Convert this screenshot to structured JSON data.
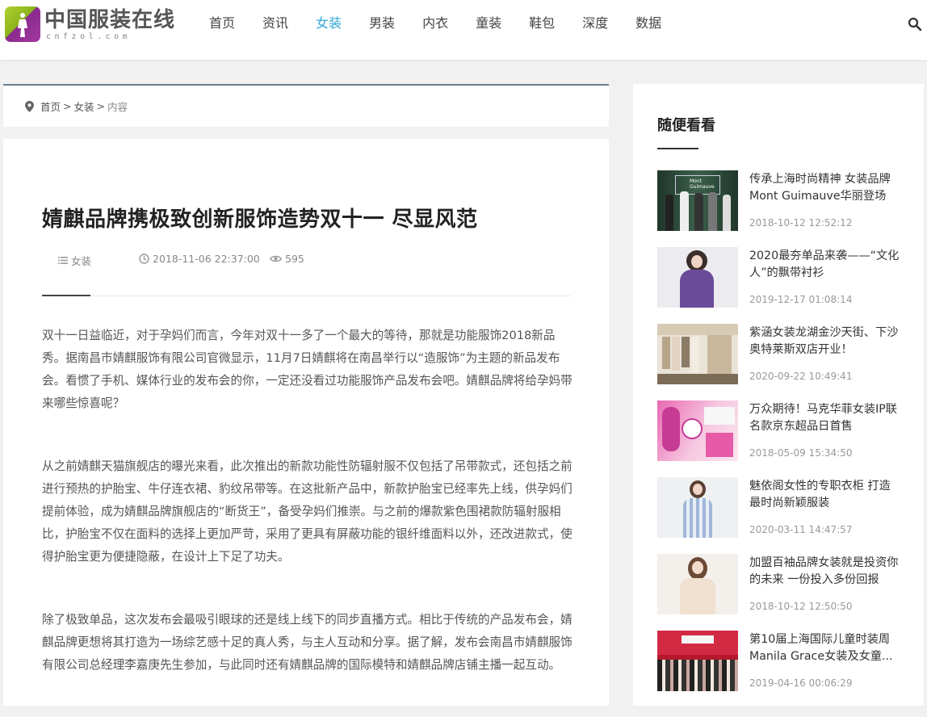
{
  "header": {
    "logo_text": "中国服装在线",
    "logo_sub": "cnfzol.com",
    "nav": [
      "首页",
      "资讯",
      "女装",
      "男装",
      "内衣",
      "童装",
      "鞋包",
      "深度",
      "数据"
    ],
    "active_nav": "女装"
  },
  "breadcrumb": {
    "home": "首页",
    "section": "女装",
    "current": "内容",
    "sep": ">"
  },
  "article": {
    "title": "婧麒品牌携极致创新服饰造势双十一 尽显风范",
    "category": "女装",
    "datetime": "2018-11-06 22:37:00",
    "views": "595",
    "paragraphs": [
      "双十一日益临近，对于孕妈们而言，今年对双十一多了一个最大的等待，那就是功能服饰2018新品秀。据南昌市婧麒服饰有限公司官微显示，11月7日婧麒将在南昌举行以“造服饰”为主题的新品发布会。看惯了手机、媒体行业的发布会的你，一定还没看过功能服饰产品发布会吧。婧麒品牌将给孕妈带来哪些惊喜呢？",
      "从之前婧麒天猫旗舰店的曝光来看，此次推出的新款功能性防辐射服不仅包括了吊带款式，还包括之前进行预热的护胎宝、牛仔连衣裙、豹纹吊带等。在这批新产品中，新款护胎宝已经率先上线，供孕妈们提前体验，成为婧麒品牌旗舰店的“断货王”，备受孕妈们推崇。与之前的爆款紫色围裙款防辐射服相比，护胎宝不仅在面料的选择上更加严苛，采用了更具有屏蔽功能的银纤维面料以外，还改进款式，使得护胎宝更为便捷隐蔽，在设计上下足了功夫。",
      "除了极致单品，这次发布会最吸引眼球的还是线上线下的同步直播方式。相比于传统的产品发布会，婧麒品牌更想将其打造为一场综艺感十足的真人秀，与主人互动和分享。据了解，发布会南昌市婧麒服饰有限公司总经理李嘉庚先生参加，与此同时还有婧麒品牌的国际模特和婧麒品牌店铺主播一起互动。"
    ]
  },
  "sidebar": {
    "title": "随便看看",
    "items": [
      {
        "title": "传承上海时尚精神 女装品牌Mont Guimauve华丽登场",
        "date": "2018-10-12 12:52:12",
        "thumb_text": "Mont Guimauve"
      },
      {
        "title": "2020最夯单品来袭——“文化人”的飘带衬衫",
        "date": "2019-12-17 01:08:14"
      },
      {
        "title": "紫涵女装龙湖金沙天街、下沙奥特莱斯双店开业！",
        "date": "2020-09-22 10:49:41"
      },
      {
        "title": "万众期待！马克华菲女装IP联名款京东超品日首售",
        "date": "2018-05-09 15:34:50"
      },
      {
        "title": "魅依阁女性的专职衣柜 打造最时尚新颖服装",
        "date": "2020-03-11 14:47:57"
      },
      {
        "title": "加盟百袖品牌女装就是投资你的未来 一份投入多份回报",
        "date": "2018-10-12 12:50:50"
      },
      {
        "title": "第10届上海国际儿童时装周Manila Grace女装及女童...",
        "date": "2019-04-16 00:06:29"
      }
    ]
  },
  "colors": {
    "accent": "#33a7d6",
    "crumb_border": "#6a7e8e"
  }
}
